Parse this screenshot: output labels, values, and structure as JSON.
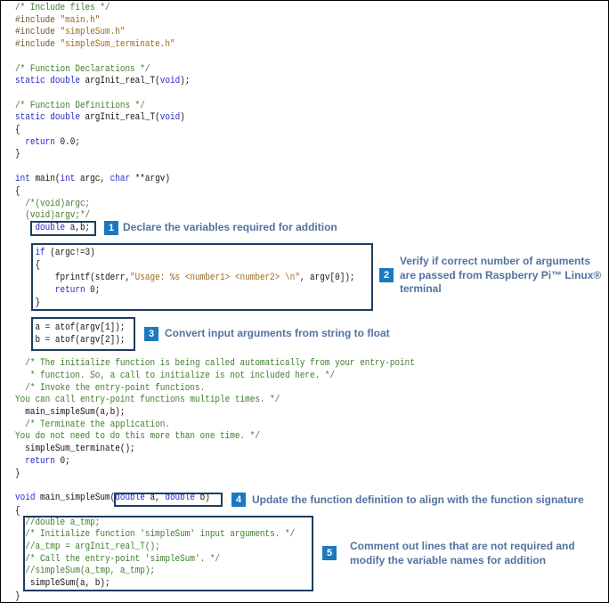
{
  "colors": {
    "keyword": "#2626cc",
    "comment": "#3d7d2a",
    "preprocessor": "#6e5530",
    "string": "#9b6a1c",
    "box_border": "#1d3d5e",
    "badge": "#1b79c0",
    "annotation_text": "#5273a0"
  },
  "code_lines": [
    [
      [
        "c",
        "/* Include files */"
      ]
    ],
    [
      [
        "p",
        "#include "
      ],
      [
        "s",
        "\"main.h\""
      ]
    ],
    [
      [
        "p",
        "#include "
      ],
      [
        "s",
        "\"simpleSum.h\""
      ]
    ],
    [
      [
        "p",
        "#include "
      ],
      [
        "s",
        "\"simpleSum_terminate.h\""
      ]
    ],
    [
      [
        "c",
        "/* Function Declarations */"
      ]
    ],
    [
      [
        "k",
        "static double "
      ],
      [
        "n",
        "argInit_real_T("
      ],
      [
        "k",
        "void"
      ],
      [
        "n",
        ");"
      ]
    ],
    [
      [
        "c",
        "/* Function Definitions */"
      ]
    ],
    [
      [
        "k",
        "static double "
      ],
      [
        "n",
        "argInit_real_T("
      ],
      [
        "k",
        "void"
      ],
      [
        "n",
        ")"
      ]
    ],
    [
      [
        "n",
        "{"
      ]
    ],
    [
      [
        "n",
        "  "
      ],
      [
        "k",
        "return"
      ],
      [
        "n",
        " 0.0;"
      ]
    ],
    [
      [
        "n",
        "}"
      ]
    ],
    [
      [
        "k",
        "int"
      ],
      [
        "n",
        " main("
      ],
      [
        "k",
        "int"
      ],
      [
        "n",
        " argc, "
      ],
      [
        "k",
        "char"
      ],
      [
        "n",
        " **argv)"
      ]
    ],
    [
      [
        "n",
        "{"
      ]
    ],
    [
      [
        "c",
        "  /*(void)argc;"
      ]
    ],
    [
      [
        "c",
        "  (void)argv;*/"
      ]
    ],
    [
      [
        "n",
        "    "
      ],
      [
        "k",
        "double"
      ],
      [
        "n",
        " a,b;"
      ]
    ],
    [
      [
        "n",
        "    "
      ],
      [
        "k",
        "if"
      ],
      [
        "n",
        " (argc!=3)"
      ]
    ],
    [
      [
        "n",
        "    {"
      ]
    ],
    [
      [
        "n",
        "        fprintf(stderr,"
      ],
      [
        "s",
        "\"Usage: %s <number1> <number2> \\n\""
      ],
      [
        "n",
        ", argv[0]);"
      ]
    ],
    [
      [
        "n",
        "        "
      ],
      [
        "k",
        "return"
      ],
      [
        "n",
        " 0;"
      ]
    ],
    [
      [
        "n",
        "    }"
      ]
    ],
    [
      [
        "n",
        "    a = atof(argv[1]);"
      ]
    ],
    [
      [
        "n",
        "    b = atof(argv[2]);"
      ]
    ],
    [
      [
        "c",
        "  /* The initialize function is being called automatically from your entry-point"
      ]
    ],
    [
      [
        "c",
        "   * function. So, a call to initialize is not included here. */"
      ]
    ],
    [
      [
        "c",
        "  /* Invoke the entry-point functions."
      ]
    ],
    [
      [
        "c",
        "You can call entry-point functions multiple times. */"
      ]
    ],
    [
      [
        "n",
        "  main_simpleSum(a,b);"
      ]
    ],
    [
      [
        "c",
        "  /* Terminate the application."
      ]
    ],
    [
      [
        "c",
        "You do not need to do this more than one time. */"
      ]
    ],
    [
      [
        "n",
        "  simpleSum_terminate();"
      ]
    ],
    [
      [
        "n",
        "  "
      ],
      [
        "k",
        "return"
      ],
      [
        "n",
        " 0;"
      ]
    ],
    [
      [
        "n",
        "}"
      ]
    ],
    [
      [
        "k",
        "void"
      ],
      [
        "n",
        " main_simpleSum("
      ],
      [
        "k",
        "double"
      ],
      [
        "n",
        " a, "
      ],
      [
        "k",
        "double"
      ],
      [
        "n",
        " b)"
      ]
    ],
    [
      [
        "n",
        "{"
      ]
    ],
    [
      [
        "c",
        "  //double a_tmp;"
      ]
    ],
    [
      [
        "c",
        "  /* Initialize function 'simpleSum' input arguments. */"
      ]
    ],
    [
      [
        "c",
        "  //a_tmp = argInit_real_T();"
      ]
    ],
    [
      [
        "c",
        "  /* Call the entry-point 'simpleSum'. */"
      ]
    ],
    [
      [
        "c",
        "  //simpleSum(a_tmp, a_tmp);"
      ]
    ],
    [
      [
        "n",
        "   simpleSum(a, b);"
      ]
    ],
    [
      [
        "n",
        "}"
      ]
    ]
  ],
  "annotations": [
    {
      "number": "1",
      "lines": [
        "Declare the variables required for addition"
      ]
    },
    {
      "number": "2",
      "lines": [
        "Verify if correct number of arguments",
        "are passed from Raspberry Pi™ Linux®",
        "terminal"
      ]
    },
    {
      "number": "3",
      "lines": [
        "Convert input arguments from string to float"
      ]
    },
    {
      "number": "4",
      "lines": [
        "Update the function definition to align with the function signature"
      ]
    },
    {
      "number": "5",
      "lines": [
        "Comment out lines that are not required and",
        "modify the variable names for addition"
      ]
    }
  ]
}
